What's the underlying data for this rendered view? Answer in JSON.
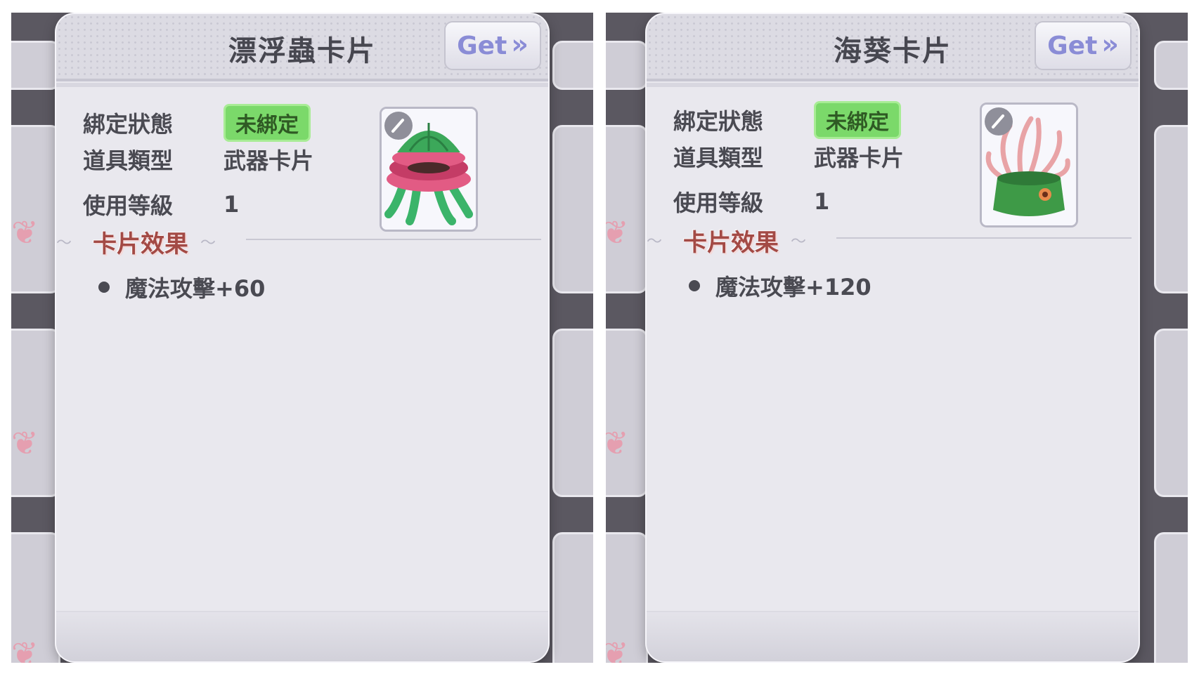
{
  "colors": {
    "bind_badge_bg": "#7bd96a",
    "get_text": "#8a8cd6",
    "effect_title": "#a34a45",
    "panel_bg": "#e9e8ee"
  },
  "panels": [
    {
      "title": "漂浮蟲卡片",
      "get_label": "Get",
      "get_icon": "double-chevron-right-icon",
      "bind_label": "綁定狀態",
      "bind_value": "未綁定",
      "type_label": "道具類型",
      "type_value": "武器卡片",
      "level_label": "使用等級",
      "level_value": "1",
      "card_icon": "jellyfish-monster-icon",
      "effect_title": "卡片效果",
      "effects": [
        "魔法攻擊+60"
      ]
    },
    {
      "title": "海葵卡片",
      "get_label": "Get",
      "get_icon": "double-chevron-right-icon",
      "bind_label": "綁定狀態",
      "bind_value": "未綁定",
      "type_label": "道具類型",
      "type_value": "武器卡片",
      "level_label": "使用等級",
      "level_value": "1",
      "card_icon": "sea-anemone-monster-icon",
      "effect_title": "卡片效果",
      "effects": [
        "魔法攻擊+120"
      ]
    }
  ]
}
